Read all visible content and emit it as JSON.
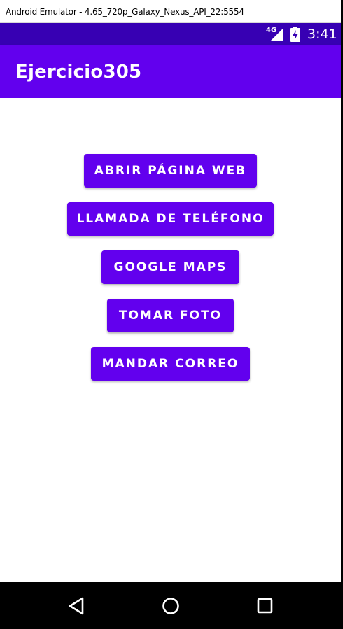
{
  "window": {
    "title": "Android Emulator - 4.65_720p_Galaxy_Nexus_API_22:5554"
  },
  "status_bar": {
    "network": "4G",
    "time": "3:41",
    "icons": [
      "signal-icon",
      "battery-charging-icon"
    ]
  },
  "app_bar": {
    "title": "Ejercicio305"
  },
  "buttons": [
    {
      "label": "ABRIR PÁGINA WEB"
    },
    {
      "label": "LLAMADA DE TELÉFONO"
    },
    {
      "label": "GOOGLE MAPS"
    },
    {
      "label": "TOMAR FOTO"
    },
    {
      "label": "MANDAR CORREO"
    }
  ],
  "nav_bar": {
    "icons": [
      "back-icon",
      "home-icon",
      "recents-icon"
    ]
  },
  "colors": {
    "primary": "#6200ee",
    "primary_dark": "#3700b3",
    "nav_bar": "#000000"
  }
}
